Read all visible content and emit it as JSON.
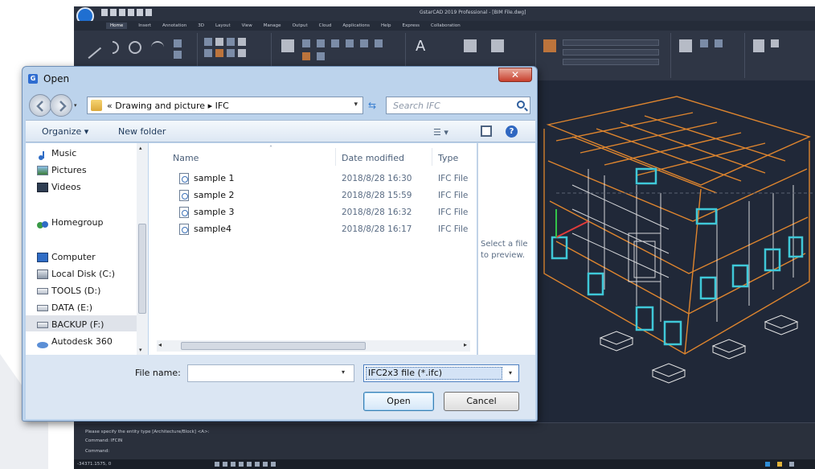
{
  "cad": {
    "title": "GstarCAD 2019 Professional - [BIM File.dwg]",
    "right_text": "",
    "ribbon_tabs": [
      "Home",
      "Insert",
      "Annotation",
      "3D",
      "Layout",
      "View",
      "Manage",
      "Output",
      "Cloud",
      "Applications",
      "Help",
      "Express",
      "Collaboration"
    ],
    "command_lines": [
      "Please specify the entity type [Architecture/Block] <A>:",
      "Command: IFCIN",
      "Command:"
    ],
    "coords": "-34371.1575, 0"
  },
  "dialog": {
    "title": "Open",
    "close_glyph": "✕",
    "address": "« Drawing and picture ▸ IFC",
    "search_placeholder": "Search IFC",
    "toolbar": {
      "organize": "Organize ▾",
      "new_folder": "New folder"
    },
    "nav_items": [
      {
        "label": "Music",
        "icon": "music-icon"
      },
      {
        "label": "Pictures",
        "icon": "pictures-icon"
      },
      {
        "label": "Videos",
        "icon": "videos-icon"
      },
      {
        "label": "Homegroup",
        "icon": "homegroup-icon"
      },
      {
        "label": "Computer",
        "icon": "computer-icon"
      },
      {
        "label": "Local Disk (C:)",
        "icon": "disk-icon"
      },
      {
        "label": "TOOLS (D:)",
        "icon": "drive-icon"
      },
      {
        "label": "DATA (E:)",
        "icon": "drive-icon"
      },
      {
        "label": "BACKUP (F:)",
        "icon": "drive-icon"
      },
      {
        "label": "Autodesk 360",
        "icon": "cloud-icon"
      }
    ],
    "columns": {
      "name": "Name",
      "date": "Date modified",
      "type": "Type"
    },
    "files": [
      {
        "name": "sample 1",
        "date": "2018/8/28 16:30",
        "type": "IFC File"
      },
      {
        "name": "sample 2",
        "date": "2018/8/28 15:59",
        "type": "IFC File"
      },
      {
        "name": "sample 3",
        "date": "2018/8/28 16:32",
        "type": "IFC File"
      },
      {
        "name": "sample4",
        "date": "2018/8/28 16:17",
        "type": "IFC File"
      }
    ],
    "preview_text": "Select a file to preview.",
    "file_name_label": "File name:",
    "file_name_value": "",
    "filter": "IFC2x3 file (*.ifc)",
    "open_label": "Open",
    "cancel_label": "Cancel"
  }
}
